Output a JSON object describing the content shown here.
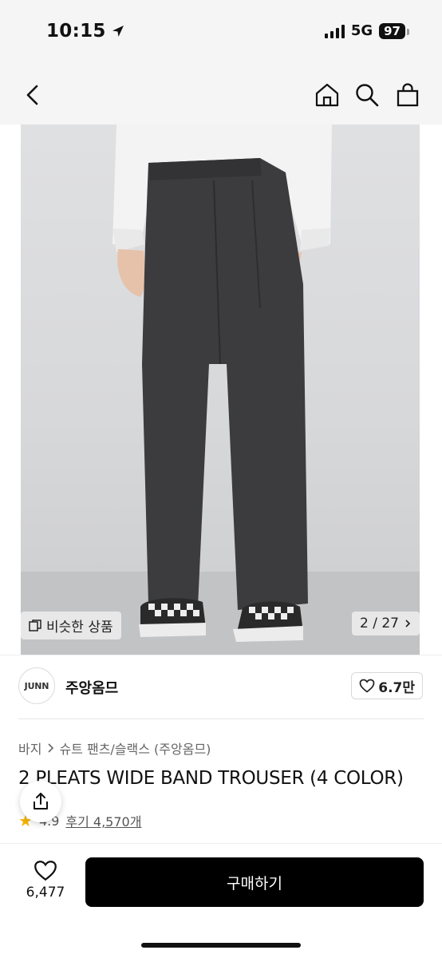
{
  "status_bar": {
    "time": "10:15",
    "network": "5G",
    "battery": "97"
  },
  "nav": {
    "icons": [
      "back-chevron-icon",
      "home-icon",
      "search-icon",
      "shopping-bag-icon"
    ]
  },
  "product_image": {
    "similar_label": "비슷한 상품",
    "counter": "2 / 27"
  },
  "brand": {
    "logo_text": "JUNN",
    "name": "주앙옴므",
    "like_count": "6.7만"
  },
  "product": {
    "breadcrumb": [
      "바지",
      "슈트 팬츠/슬랙스 (주앙옴므)"
    ],
    "title": "2 PLEATS WIDE BAND TROUSER (4 COLOR)",
    "rating": "4.9",
    "review_label": "후기 4,570개"
  },
  "bottom_bar": {
    "wish_count": "6,477",
    "buy_label": "구매하기"
  },
  "colors": {
    "accent": "#000000",
    "star": "#f5b301",
    "background": "#ffffff"
  }
}
